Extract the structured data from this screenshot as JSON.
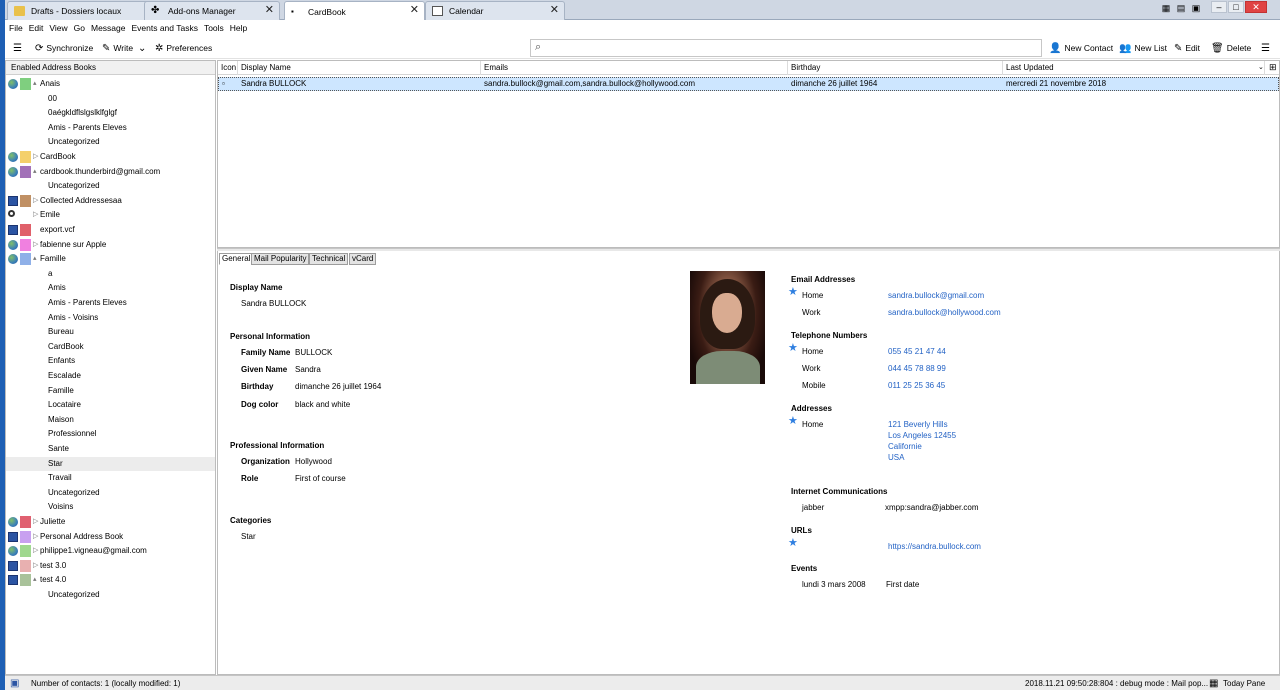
{
  "tabs": [
    {
      "label": "Drafts - Dossiers locaux"
    },
    {
      "label": "Add-ons Manager"
    },
    {
      "label": "CardBook"
    },
    {
      "label": "Calendar"
    }
  ],
  "menu": [
    "File",
    "Edit",
    "View",
    "Go",
    "Message",
    "Events and Tasks",
    "Tools",
    "Help"
  ],
  "toolbar": {
    "synchronize": "Synchronize",
    "write": "Write",
    "preferences": "Preferences",
    "new_contact": "New Contact",
    "new_list": "New List",
    "edit": "Edit",
    "delete": "Delete"
  },
  "search": {
    "placeholder": ""
  },
  "sidebar": {
    "header": "Enabled Address Books",
    "items": [
      {
        "label": "Anais",
        "icon": "globe",
        "color": "#7fcf7f",
        "twisty": "▴",
        "level": 0
      },
      {
        "label": "00",
        "level": 1
      },
      {
        "label": "0aégkldflslgslklfglgf",
        "level": 1
      },
      {
        "label": "Amis - Parents Eleves",
        "level": 1
      },
      {
        "label": "Uncategorized",
        "level": 1
      },
      {
        "label": "CardBook",
        "icon": "globe",
        "color": "#f4d06c",
        "twisty": "▷",
        "level": 0
      },
      {
        "label": "cardbook.thunderbird@gmail.com",
        "icon": "globe",
        "color": "#a271b8",
        "twisty": "▴",
        "level": 0
      },
      {
        "label": "Uncategorized",
        "level": 1
      },
      {
        "label": "Collected Addressesaa",
        "icon": "monitor",
        "color": "#c09064",
        "twisty": "▷",
        "level": 0
      },
      {
        "label": "Emile",
        "icon": "search",
        "color": "",
        "twisty": "▷",
        "level": 0
      },
      {
        "label": "export.vcf",
        "icon": "monitor",
        "color": "#e0606a",
        "twisty": "",
        "level": 0
      },
      {
        "label": "fabienne sur Apple",
        "icon": "globe",
        "color": "#f080e0",
        "twisty": "▷",
        "level": 0
      },
      {
        "label": "Famille",
        "icon": "globe",
        "color": "#8fb0e8",
        "twisty": "▴",
        "level": 0
      },
      {
        "label": "a",
        "level": 1
      },
      {
        "label": "Amis",
        "level": 1
      },
      {
        "label": "Amis - Parents Eleves",
        "level": 1
      },
      {
        "label": "Amis - Voisins",
        "level": 1
      },
      {
        "label": "Bureau",
        "level": 1
      },
      {
        "label": "CardBook",
        "level": 1
      },
      {
        "label": "Enfants",
        "level": 1
      },
      {
        "label": "Escalade",
        "level": 1
      },
      {
        "label": "Famille",
        "level": 1
      },
      {
        "label": "Locataire",
        "level": 1
      },
      {
        "label": "Maison",
        "level": 1
      },
      {
        "label": "Professionnel",
        "level": 1
      },
      {
        "label": "Sante",
        "level": 1
      },
      {
        "label": "Star",
        "level": 1,
        "selected": true
      },
      {
        "label": "Travail",
        "level": 1
      },
      {
        "label": "Uncategorized",
        "level": 1
      },
      {
        "label": "Voisins",
        "level": 1
      },
      {
        "label": "Juliette",
        "icon": "globe",
        "color": "#e06070",
        "twisty": "▷",
        "level": 0
      },
      {
        "label": "Personal Address Book",
        "icon": "monitor",
        "color": "#c8a0f0",
        "twisty": "▷",
        "level": 0
      },
      {
        "label": "philippe1.vigneau@gmail.com",
        "icon": "globe",
        "color": "#9fd88f",
        "twisty": "▷",
        "level": 0
      },
      {
        "label": "test 3.0",
        "icon": "monitor",
        "color": "#e8b0b0",
        "twisty": "▷",
        "level": 0
      },
      {
        "label": "test 4.0",
        "icon": "monitor",
        "color": "#a9c29a",
        "twisty": "▴",
        "level": 0
      },
      {
        "label": "Uncategorized",
        "level": 1
      }
    ]
  },
  "list": {
    "columns": [
      "Icon",
      "Display Name",
      "Emails",
      "Birthday",
      "Last Updated"
    ],
    "rows": [
      {
        "display_name": "Sandra BULLOCK",
        "emails": "sandra.bullock@gmail.com,sandra.bullock@hollywood.com",
        "birthday": "dimanche 26 juillet 1964",
        "last_updated": "mercredi 21 novembre 2018"
      }
    ]
  },
  "detail": {
    "tabs": [
      "General",
      "Mail Popularity",
      "Technical",
      "vCard"
    ],
    "display_name_label": "Display Name",
    "display_name": "Sandra BULLOCK",
    "personal_label": "Personal Information",
    "family_name_label": "Family Name",
    "family_name": "BULLOCK",
    "given_name_label": "Given Name",
    "given_name": "Sandra",
    "birthday_label": "Birthday",
    "birthday": "dimanche 26 juillet 1964",
    "dog_color_label": "Dog color",
    "dog_color": "black and white",
    "professional_label": "Professional Information",
    "organization_label": "Organization",
    "organization": "Hollywood",
    "role_label": "Role",
    "role": "First of course",
    "categories_label": "Categories",
    "category": "Star",
    "email_label": "Email Addresses",
    "email_home_type": "Home",
    "email_home": "sandra.bullock@gmail.com",
    "email_work_type": "Work",
    "email_work": "sandra.bullock@hollywood.com",
    "phone_label": "Telephone Numbers",
    "phone_home_type": "Home",
    "phone_home": "055 45 21 47 44",
    "phone_work_type": "Work",
    "phone_work": "044 45 78 88 99",
    "phone_mobile_type": "Mobile",
    "phone_mobile": "011 25 25 36 45",
    "address_label": "Addresses",
    "address_type": "Home",
    "address_line1": "121 Beverly Hills",
    "address_line2": "Los Angeles 12455",
    "address_line3": "Californie",
    "address_line4": "USA",
    "im_label": "Internet Communications",
    "im_type": "jabber",
    "im_value": "xmpp:sandra@jabber.com",
    "urls_label": "URLs",
    "url": "https://sandra.bullock.com",
    "events_label": "Events",
    "event_date": "lundi 3 mars 2008",
    "event_name": "First date"
  },
  "status": {
    "left": "Number of contacts: 1 (locally modified: 1)",
    "right": "2018.11.21 09:50:28:804 : debug mode : Mail pop...",
    "today_pane": "Today Pane"
  },
  "colors": {
    "accent": "#2463c5",
    "selection": "#cde6ff",
    "window_frame": "#1e5fb4"
  }
}
